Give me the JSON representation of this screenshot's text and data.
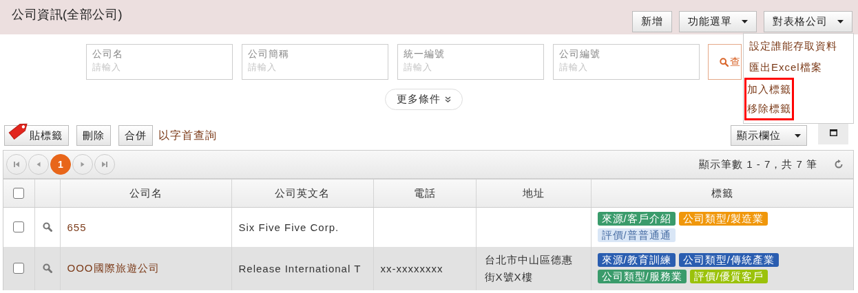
{
  "header": {
    "title": "公司資訊(全部公司)",
    "buttons": [
      {
        "label": "新增",
        "kind": "plain"
      },
      {
        "label": "功能選單",
        "kind": "dropdown"
      },
      {
        "label": "對表格公司",
        "kind": "dropdown"
      }
    ]
  },
  "menu": {
    "items": [
      {
        "label": "設定誰能存取資料",
        "highlighted": false
      },
      {
        "label": "匯出Excel檔案",
        "highlighted": false
      },
      {
        "label": "加入標籤",
        "highlighted": true
      },
      {
        "label": "移除標籤",
        "highlighted": true
      }
    ]
  },
  "filters": {
    "fields": [
      {
        "label": "公司名",
        "placeholder": "請輸入"
      },
      {
        "label": "公司簡稱",
        "placeholder": "請輸入"
      },
      {
        "label": "統一編號",
        "placeholder": "請輸入"
      },
      {
        "label": "公司編號",
        "placeholder": "請輸入"
      }
    ],
    "search_button": "查",
    "more_button": "更多條件"
  },
  "toolbar": {
    "buttons": [
      {
        "label": "貼標籤",
        "kind": "tag"
      },
      {
        "label": "刪除",
        "kind": "plain"
      },
      {
        "label": "合併",
        "kind": "plain"
      }
    ],
    "link": "以字首查詢",
    "columns_button": "顯示欄位"
  },
  "pager": {
    "pages": [
      {
        "label": "1",
        "selected": true
      }
    ],
    "summary": "顯示筆數 1 - 7，共 7 筆"
  },
  "table": {
    "columns": [
      "公司名",
      "公司英文名",
      "電話",
      "地址",
      "標籤"
    ],
    "all_checked": false,
    "rows": [
      {
        "checked": false,
        "name": "655",
        "english_name": "Six Five Five Corp.",
        "phone": "",
        "address": "",
        "tags": [
          {
            "text": "來源/客戶介紹",
            "color": "#3a9b6b"
          },
          {
            "text": "公司類型/製造業",
            "color": "#f0970b"
          },
          {
            "text": "評價/普普通通",
            "color": "#d9e6f6"
          }
        ]
      },
      {
        "checked": false,
        "name": "OOO國際旅遊公司",
        "english_name": "Release International T",
        "phone": "xx-xxxxxxxx",
        "address": "台北市中山區德惠街X號X樓",
        "tags": [
          {
            "text": "來源/教育訓練",
            "color": "#2a5db0"
          },
          {
            "text": "公司類型/傳統產業",
            "color": "#2a5db0"
          },
          {
            "text": "公司類型/服務業",
            "color": "#3a9b6b"
          },
          {
            "text": "評價/優質客戶",
            "color": "#9bc20b"
          }
        ]
      }
    ]
  }
}
